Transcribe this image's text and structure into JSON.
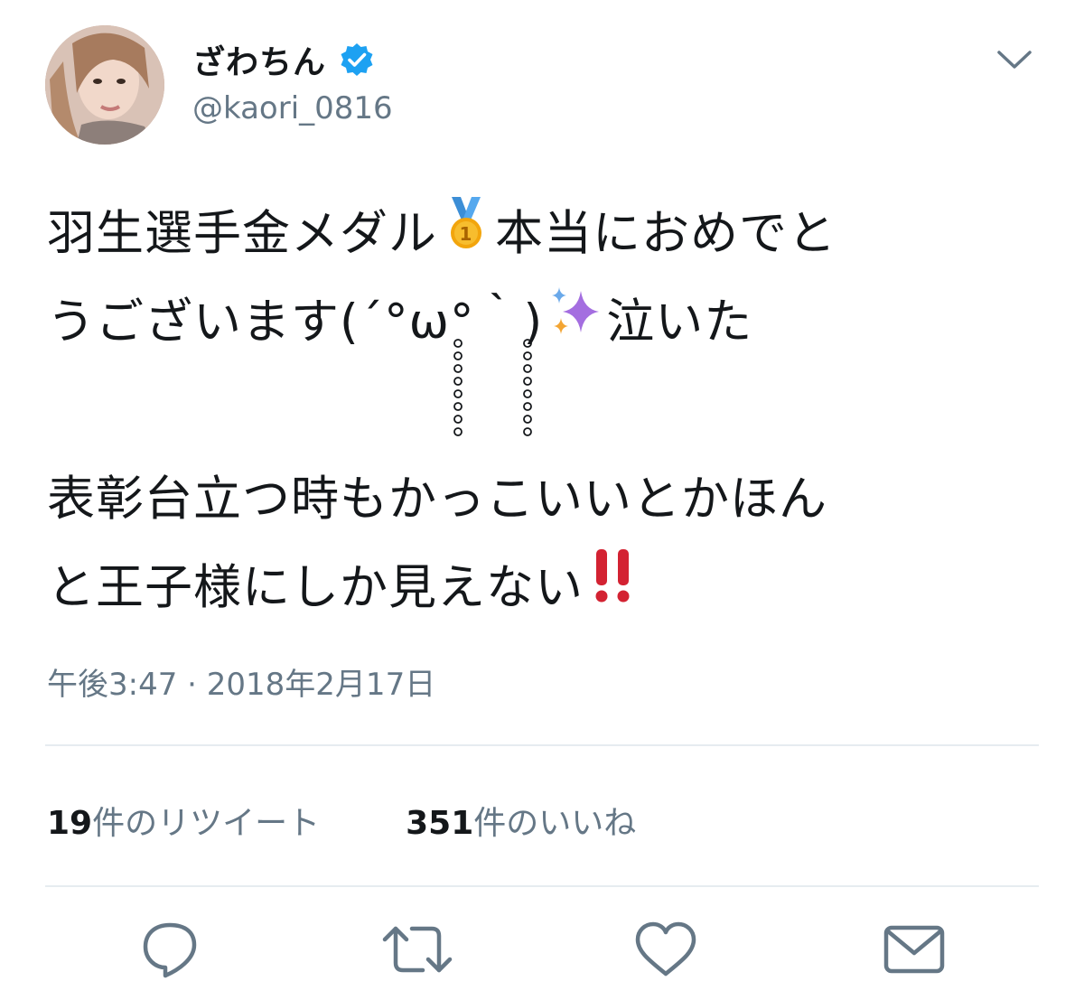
{
  "user": {
    "display_name": "ざわちん",
    "handle": "@kaori_0816",
    "verified": true
  },
  "tweet": {
    "line1_a": "羽生選手金メダル",
    "line1_b": "本当におめでと",
    "line2_a": "うございます(´°ω°｀)",
    "line2_b": "泣いた",
    "line3": "表彰台立つ時もかっこいいとかほん",
    "line4": "と王子様にしか見えない",
    "emojis": [
      "medal-emoji",
      "sparkles-emoji",
      "double-exclamation-emoji"
    ]
  },
  "timestamp": "午後3:47 · 2018年2月17日",
  "stats": {
    "retweets_count": "19",
    "retweets_label": "件のリツイート",
    "likes_count": "351",
    "likes_label": "件のいいね"
  },
  "actions": {
    "icons": [
      "reply-icon",
      "retweet-icon",
      "like-icon",
      "share-icon"
    ]
  },
  "colors": {
    "text": "#14171a",
    "secondary": "#657786",
    "verified": "#1da1f2",
    "divider": "#e6ecf0"
  }
}
